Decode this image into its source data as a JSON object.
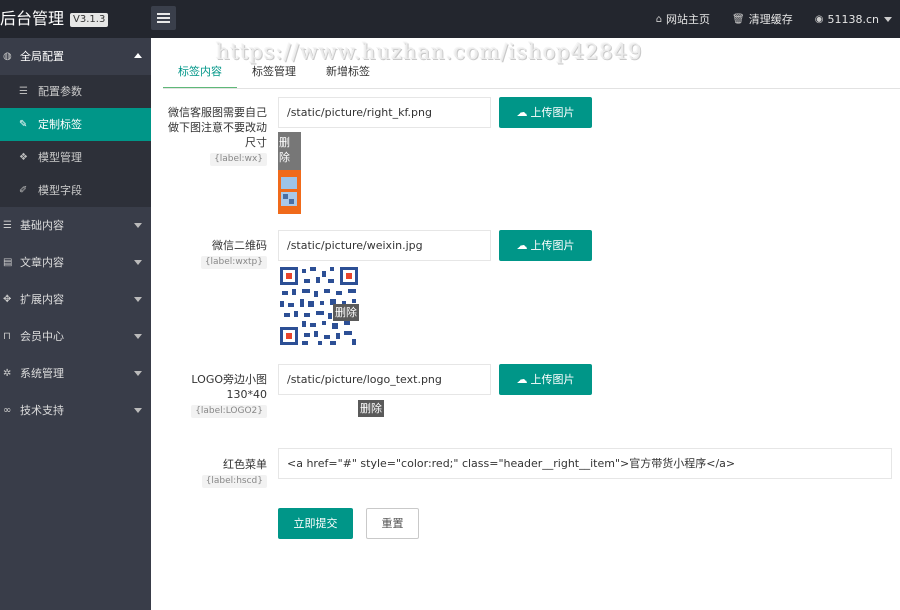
{
  "header": {
    "brand": "后台管理",
    "version": "V3.1.3",
    "links": {
      "site_home": "网站主页",
      "clear_cache": "清理缓存",
      "user": "51138.cn"
    }
  },
  "sidebar": {
    "groups": {
      "global": "全局配置",
      "basic": "基础内容",
      "article": "文章内容",
      "extend": "扩展内容",
      "member": "会员中心",
      "system": "系统管理",
      "support": "技术支持"
    },
    "sub_items": {
      "params": "配置参数",
      "labels": "定制标签",
      "models": "模型管理",
      "fields": "模型字段"
    }
  },
  "watermark": "https://www.huzhan.com/ishop42849",
  "tabs": {
    "content": "标签内容",
    "manage": "标签管理",
    "add": "新增标签"
  },
  "form": {
    "upload_label": "上传图片",
    "delete_label": "删除",
    "rows": {
      "kf": {
        "label": "微信客服图需要自己做下图注意不要改动尺寸",
        "tag": "{label:wx}",
        "value": "/static/picture/right_kf.png"
      },
      "wxtp": {
        "label": "微信二维码",
        "tag": "{label:wxtp}",
        "value": "/static/picture/weixin.jpg"
      },
      "logo": {
        "label": "LOGO旁边小图130*40",
        "tag": "{label:LOGO2}",
        "value": "/static/picture/logo_text.png"
      },
      "hscd": {
        "label": "红色菜单",
        "tag": "{label:hscd}",
        "value": "<a href=\"#\" style=\"color:red;\" class=\"header__right__item\">官方带货小程序</a>"
      }
    },
    "submit": "立即提交",
    "reset": "重置"
  },
  "colors": {
    "accent": "#009688",
    "header_bg": "#23262e",
    "sidebar_bg": "#393d49",
    "sidebar_sub_bg": "#2d3039"
  }
}
